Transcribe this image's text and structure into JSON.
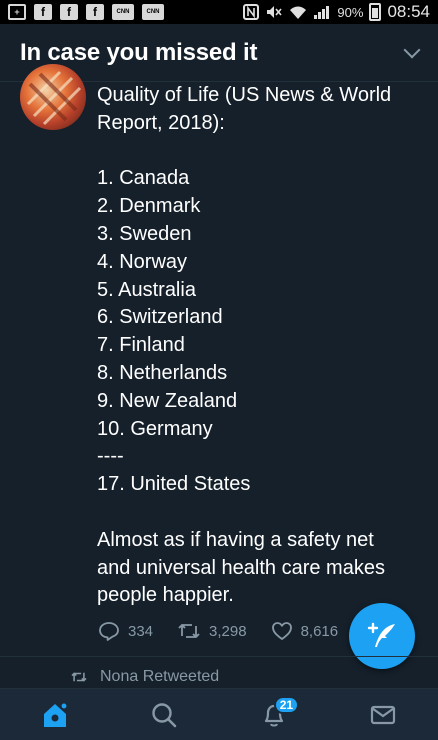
{
  "status_bar": {
    "battery": "90%",
    "time": "08:54",
    "notification_icons": [
      "plus-box-icon",
      "facebook-icon",
      "facebook-icon",
      "facebook-icon",
      "cnn-icon",
      "cnn-icon"
    ],
    "cnn_label": "CNN",
    "fb_label": "f",
    "plus_label": "+"
  },
  "header": {
    "title": "In case you missed it"
  },
  "tweet": {
    "lines": [
      "Quality of Life (US News & World",
      "Report, 2018):",
      "",
      "1. Canada",
      "2. Denmark",
      "3. Sweden",
      "4. Norway",
      "5. Australia",
      "6. Switzerland",
      "7. Finland",
      "8. Netherlands",
      "9. New Zealand",
      "10. Germany",
      "----",
      "17. United States",
      "",
      "Almost as if having a safety net",
      "and universal health care makes",
      "people happier."
    ],
    "reply_count": "334",
    "retweet_count": "3,298",
    "like_count": "8,616"
  },
  "retweeted_by": "Nona Retweeted",
  "nav": {
    "notifications_badge": "21"
  },
  "colors": {
    "background": "#15202b",
    "accent": "#1da1f2",
    "secondary_text": "#8899a6",
    "nav_background": "#1c2938"
  }
}
